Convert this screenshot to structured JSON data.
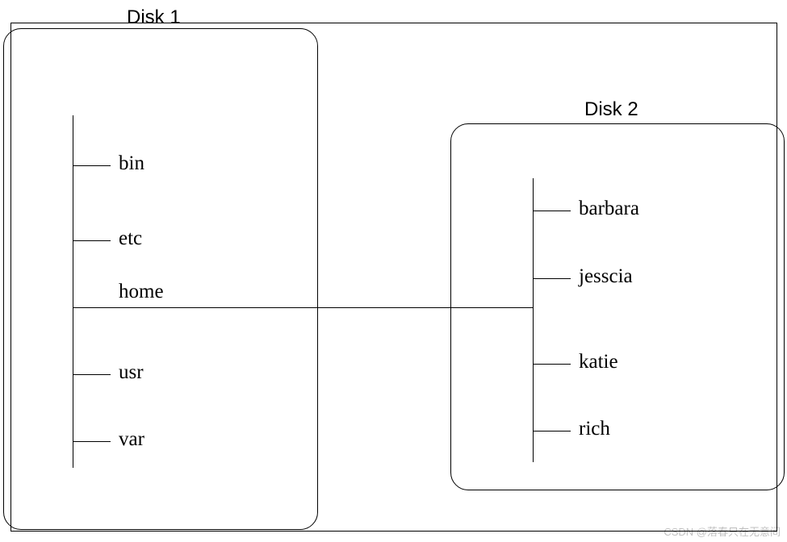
{
  "disk1": {
    "title": "Disk 1",
    "items": {
      "bin": "bin",
      "etc": "etc",
      "home": "home",
      "usr": "usr",
      "var": "var"
    }
  },
  "disk2": {
    "title": "Disk 2",
    "items": {
      "barbara": "barbara",
      "jesscia": "jesscia",
      "katie": "katie",
      "rich": "rich"
    }
  },
  "watermark": "CSDN @落春只在无意间"
}
